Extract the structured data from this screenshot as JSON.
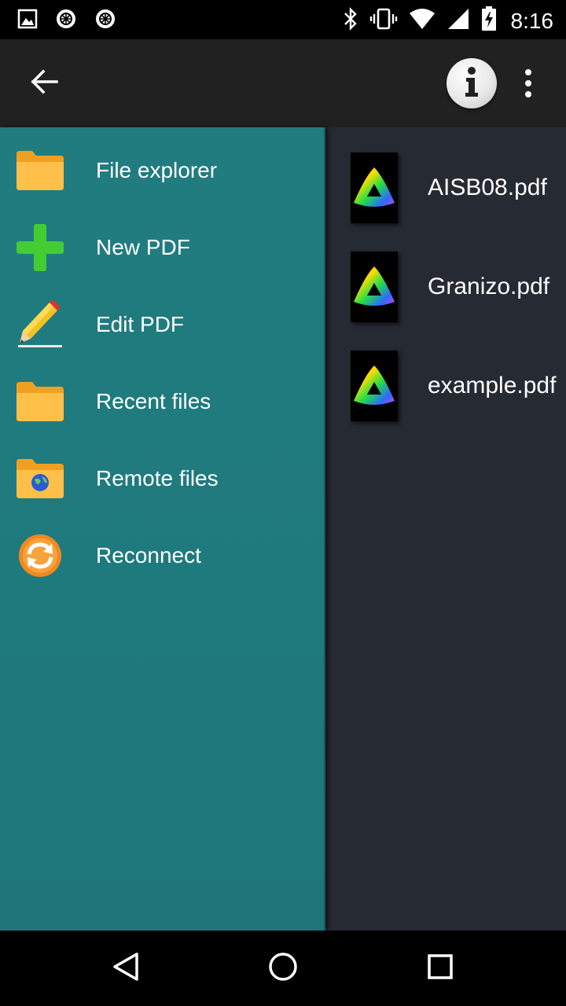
{
  "status_bar": {
    "time": "8:16",
    "left_icons": [
      "image-notification-icon",
      "app-notification-icon",
      "app-notification-icon"
    ],
    "right_icons": [
      "bluetooth-icon",
      "vibrate-icon",
      "wifi-icon",
      "signal-icon",
      "battery-charging-icon"
    ]
  },
  "app_bar": {
    "back_icon": "arrow-left-icon",
    "info_icon": "info-icon",
    "overflow_icon": "more-vert-icon"
  },
  "drawer": {
    "items": [
      {
        "label": "File explorer",
        "icon": "folder-icon"
      },
      {
        "label": "New PDF",
        "icon": "plus-icon"
      },
      {
        "label": "Edit PDF",
        "icon": "pencil-icon"
      },
      {
        "label": "Recent files",
        "icon": "folder-icon"
      },
      {
        "label": "Remote files",
        "icon": "globe-folder-icon"
      },
      {
        "label": "Reconnect",
        "icon": "refresh-icon"
      }
    ],
    "colors": {
      "background": "#217c80"
    }
  },
  "files": [
    {
      "name": "AISB08.pdf"
    },
    {
      "name": "Granizo.pdf"
    },
    {
      "name": "example.pdf"
    }
  ],
  "nav_bar": {
    "icons": [
      "back-triangle-icon",
      "home-circle-icon",
      "recents-square-icon"
    ]
  },
  "colors": {
    "app_bar": "#212121",
    "content_background": "#262a33",
    "drawer": "#217c80"
  }
}
